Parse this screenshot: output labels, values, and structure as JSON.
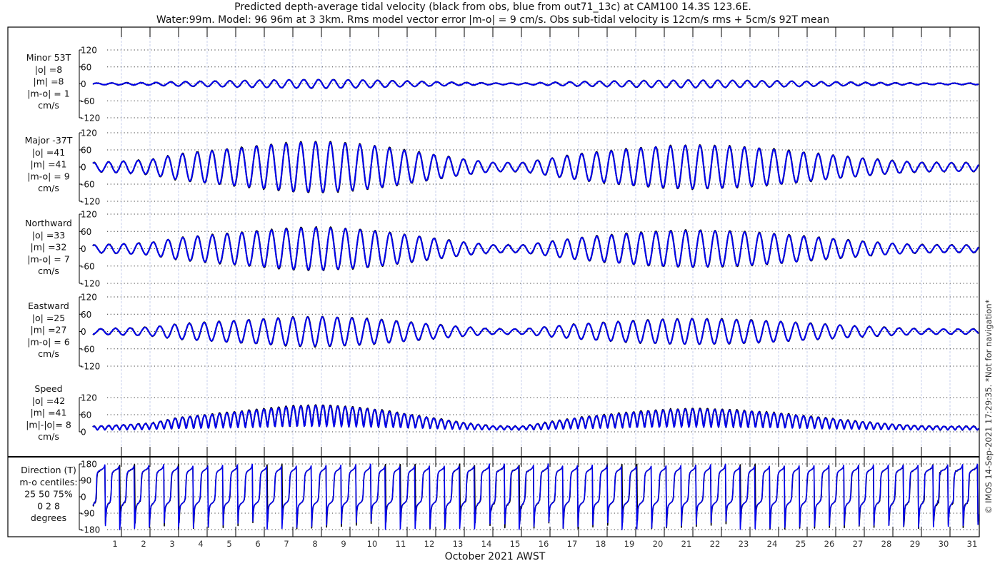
{
  "title_line1": "Predicted depth-average tidal velocity (black from obs, blue from out71_13c) at CAM100 14.3S 123.6E.",
  "title_line2": "Water:99m. Model: 96 96m at 3 3km. Rms model vector error |m-o| = 9 cm/s. Obs sub-tidal velocity is 12cm/s rms + 5cm/s 92T mean",
  "side_note": "© IMOS 14-Sep-2021 17:29:35. *Not for navigation*",
  "colors": {
    "obs": "#000000",
    "model": "#0000ee",
    "grid_v": "#c8d2ee"
  },
  "chart_data": {
    "type": "line",
    "xlabel": "October 2021 AWST",
    "x_ticks": [
      "1",
      "2",
      "3",
      "4",
      "5",
      "6",
      "7",
      "8",
      "9",
      "10",
      "11",
      "12",
      "13",
      "14",
      "15",
      "16",
      "17",
      "18",
      "19",
      "20",
      "21",
      "22",
      "23",
      "24",
      "25",
      "26",
      "27",
      "28",
      "29",
      "30",
      "31"
    ],
    "xlim_days": [
      1,
      32
    ],
    "legend": "black = obs, blue = model",
    "major_amplitude_by_day_cm_s": [
      15,
      20,
      25,
      45,
      55,
      65,
      75,
      85,
      88,
      82,
      72,
      57,
      42,
      27,
      16,
      15,
      30,
      45,
      55,
      65,
      72,
      76,
      73,
      68,
      60,
      50,
      40,
      30,
      22,
      16,
      15
    ],
    "panels": [
      {
        "id": "minor",
        "labels": [
          "Minor 53T",
          "|o| =8",
          "|m| =8",
          "|m-o| = 1",
          "cm/s"
        ],
        "yticks": [
          "120",
          "60",
          "0",
          "-60",
          "-120"
        ],
        "ylim": [
          -120,
          120
        ],
        "amp_factor": 0.17
      },
      {
        "id": "major",
        "labels": [
          "Major -37T",
          "|o| =41",
          "|m| =41",
          "|m-o| = 9",
          "cm/s"
        ],
        "yticks": [
          "120",
          "60",
          "0",
          "-60",
          "-120"
        ],
        "ylim": [
          -120,
          120
        ],
        "amp_factor": 1.0
      },
      {
        "id": "north",
        "labels": [
          "Northward",
          "|o| =33",
          "|m| =32",
          "|m-o| = 7",
          "cm/s"
        ],
        "yticks": [
          "120",
          "60",
          "0",
          "-60",
          "-120"
        ],
        "ylim": [
          -120,
          120
        ],
        "amp_factor": 0.8
      },
      {
        "id": "east",
        "labels": [
          "Eastward",
          "|o| =25",
          "|m| =27",
          "|m-o| = 6",
          "cm/s"
        ],
        "yticks": [
          "120",
          "60",
          "0",
          "-60",
          "-120"
        ],
        "ylim": [
          -120,
          120
        ],
        "amp_factor": 0.62
      },
      {
        "id": "speed",
        "labels": [
          "Speed",
          "|o| =42",
          "|m| =41",
          "|m|-|o|= 8",
          "cm/s"
        ],
        "yticks": [
          "120",
          "60",
          "0"
        ],
        "ylim": [
          0,
          120
        ],
        "amp_factor": 1.0
      },
      {
        "id": "direction",
        "labels": [
          "Direction (T)",
          "m-o centiles:",
          "25  50  75%",
          "0  2  8",
          "degrees"
        ],
        "yticks": [
          "180",
          "90",
          "0",
          "-90",
          "-180"
        ],
        "ylim": [
          -180,
          180
        ],
        "amp_factor": 1.0
      }
    ]
  }
}
